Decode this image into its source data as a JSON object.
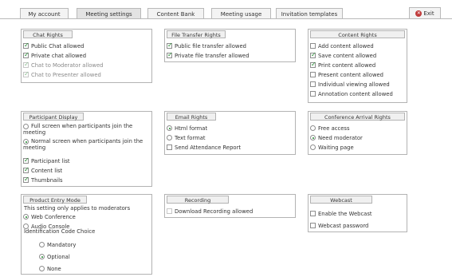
{
  "tabs": [
    {
      "label": "My account",
      "active": false
    },
    {
      "label": "Meeting settings",
      "active": true
    },
    {
      "label": "Content Bank",
      "active": false
    },
    {
      "label": "Meeting usage",
      "active": false
    },
    {
      "label": "Invitation templates",
      "active": false
    }
  ],
  "exit": {
    "label": "Exit",
    "icon": "close-icon"
  },
  "panels": {
    "chat_rights": {
      "title": "Chat Rights",
      "items": [
        {
          "label": "Public Chat allowed",
          "checked": true,
          "disabled": false
        },
        {
          "label": "Private chat allowed",
          "checked": true,
          "disabled": false
        },
        {
          "label": "Chat to Moderator allowed",
          "checked": true,
          "disabled": true
        },
        {
          "label": "Chat to Presenter allowed",
          "checked": true,
          "disabled": true
        }
      ]
    },
    "file_transfer_rights": {
      "title": "File Transfer Rights",
      "items": [
        {
          "label": "Public file transfer allowed",
          "checked": true
        },
        {
          "label": "Private file transfer allowed",
          "checked": true
        }
      ]
    },
    "content_rights": {
      "title": "Content Rights",
      "items": [
        {
          "label": "Add content allowed",
          "checked": false
        },
        {
          "label": "Save content allowed",
          "checked": true
        },
        {
          "label": "Print content allowed",
          "checked": true
        },
        {
          "label": "Present content allowed",
          "checked": false
        },
        {
          "label": "Individual viewing allowed",
          "checked": false
        },
        {
          "label": "Annotation content allowed",
          "checked": false
        }
      ]
    },
    "participant_display": {
      "title": "Participant Display",
      "radios": [
        {
          "label": "Full screen when participants join the meeting",
          "selected": false
        },
        {
          "label": "Normal screen when participants join the meeting",
          "selected": true
        }
      ],
      "items": [
        {
          "label": "Participant list",
          "checked": true
        },
        {
          "label": "Content list",
          "checked": true
        },
        {
          "label": "Thumbnails",
          "checked": true
        }
      ]
    },
    "email_rights": {
      "title": "Email Rights",
      "radios": [
        {
          "label": "Html format",
          "selected": true
        },
        {
          "label": "Text format",
          "selected": false
        }
      ],
      "items": [
        {
          "label": "Send Attendance Report",
          "checked": false
        }
      ]
    },
    "conference_arrival_rights": {
      "title": "Conference Arrival Rights",
      "radios": [
        {
          "label": "Free access",
          "selected": false
        },
        {
          "label": "Need moderator",
          "selected": true
        },
        {
          "label": "Waiting page",
          "selected": false
        }
      ]
    },
    "product_entry_mode": {
      "title": "Product Entry Mode",
      "note": "This setting only applies to moderators",
      "radios": [
        {
          "label": "Web Conference",
          "selected": true
        },
        {
          "label": "Audio Console",
          "selected": false
        }
      ],
      "sub_title": "Identification Code Choice",
      "sub_radios": [
        {
          "label": "Mandatory",
          "selected": false
        },
        {
          "label": "Optional",
          "selected": true
        },
        {
          "label": "None",
          "selected": false
        }
      ]
    },
    "recording": {
      "title": "Recording",
      "items": [
        {
          "label": "Download Recording allowed",
          "checked": false,
          "disabled": true
        }
      ]
    },
    "webcast": {
      "title": "Webcast",
      "items": [
        {
          "label": "Enable the Webcast",
          "checked": false
        },
        {
          "label": "Webcast password",
          "checked": false
        }
      ]
    }
  }
}
